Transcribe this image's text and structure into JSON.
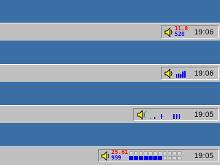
{
  "colors": {
    "desktop": "#3a6ea5",
    "taskbar": "#c0c0c0",
    "meter_red": "#ff0000",
    "meter_blue": "#0000ff"
  },
  "taskbars": [
    {
      "clock": "19:06",
      "meter": {
        "top": "11.8",
        "bottom": "528"
      }
    },
    {
      "clock": "19:06"
    },
    {
      "clock": "19:05"
    },
    {
      "clock": "19:05",
      "meter": {
        "top": "25.61",
        "bottom": "999"
      }
    }
  ],
  "icons": {
    "speaker": "speaker-icon"
  }
}
